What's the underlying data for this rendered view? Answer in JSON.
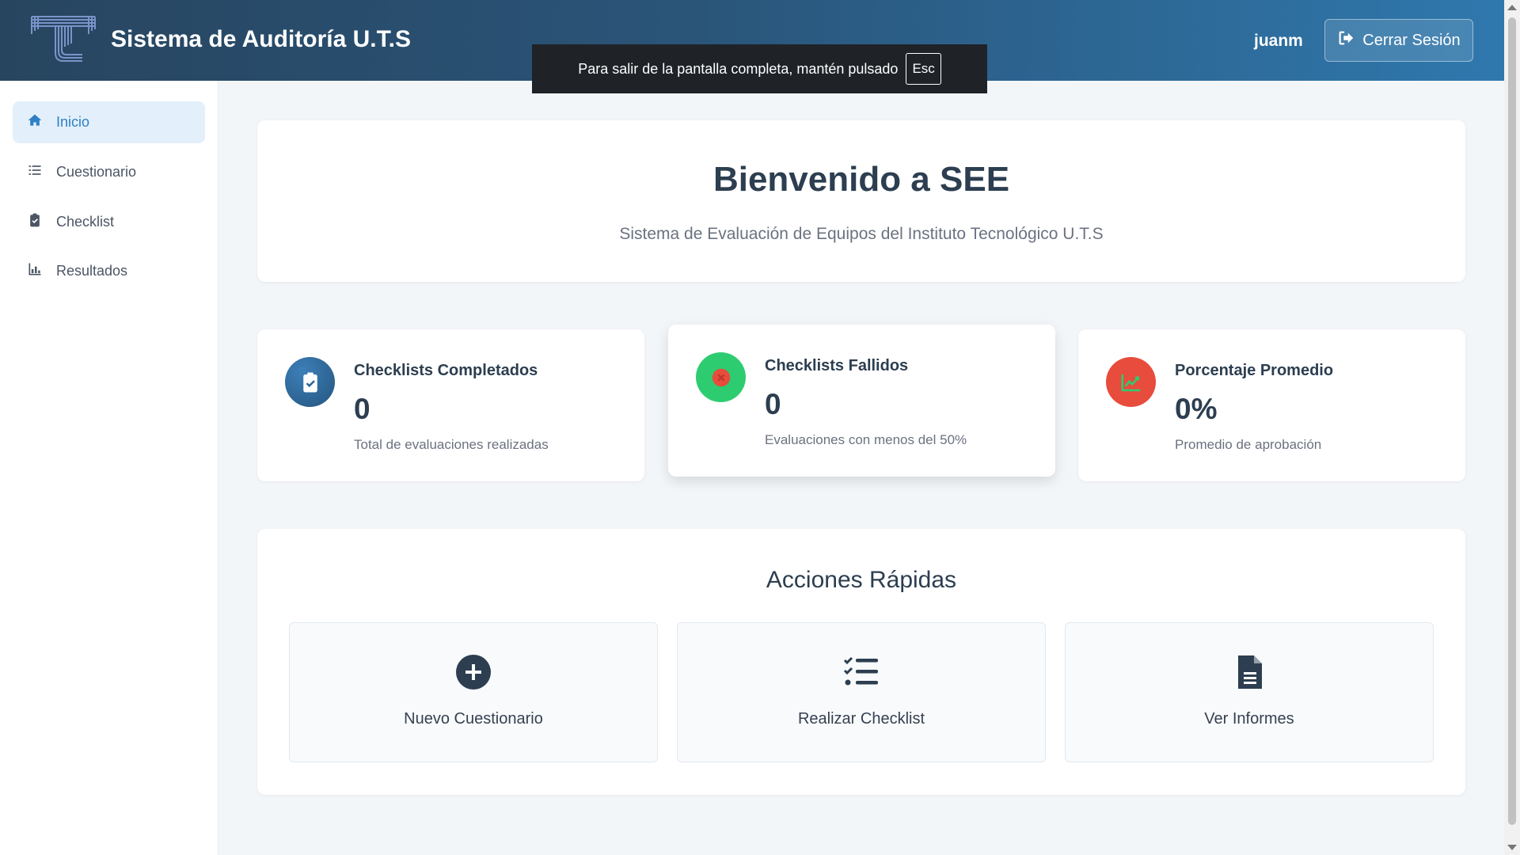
{
  "header": {
    "title": "Sistema de Auditoría U.T.S",
    "username": "juanm",
    "logout_label": "Cerrar Sesión",
    "logo_icon": "uts-logo-icon"
  },
  "fullscreen_notice": {
    "text": "Para salir de la pantalla completa, mantén pulsado",
    "key": "Esc"
  },
  "sidebar": {
    "items": [
      {
        "label": "Inicio",
        "icon": "home-icon",
        "active": true
      },
      {
        "label": "Cuestionario",
        "icon": "list-icon",
        "active": false
      },
      {
        "label": "Checklist",
        "icon": "clipboard-check-icon",
        "active": false
      },
      {
        "label": "Resultados",
        "icon": "bar-chart-icon",
        "active": false
      }
    ]
  },
  "welcome": {
    "title": "Bienvenido a SEE",
    "subtitle": "Sistema de Evaluación de Equipos del Instituto Tecnológico U.T.S"
  },
  "stats": [
    {
      "title": "Checklists Completados",
      "value": "0",
      "description": "Total de evaluaciones realizadas",
      "icon": "clipboard-check-icon",
      "color": "#2a6496"
    },
    {
      "title": "Checklists Fallidos",
      "value": "0",
      "description": "Evaluaciones con menos del 50%",
      "icon": "x-circle-icon",
      "color": "#2ecc71"
    },
    {
      "title": "Porcentaje Promedio",
      "value": "0%",
      "description": "Promedio de aprobación",
      "icon": "line-chart-icon",
      "color": "#e74c3c"
    }
  ],
  "quick_actions": {
    "title": "Acciones Rápidas",
    "items": [
      {
        "label": "Nuevo Cuestionario",
        "icon": "plus-circle-icon"
      },
      {
        "label": "Realizar Checklist",
        "icon": "tasks-list-icon"
      },
      {
        "label": "Ver Informes",
        "icon": "file-text-icon"
      }
    ]
  },
  "colors": {
    "header_start": "#27455f",
    "header_end": "#2f78ad",
    "accent": "#2f80c4",
    "text_dark": "#2c3e50"
  }
}
